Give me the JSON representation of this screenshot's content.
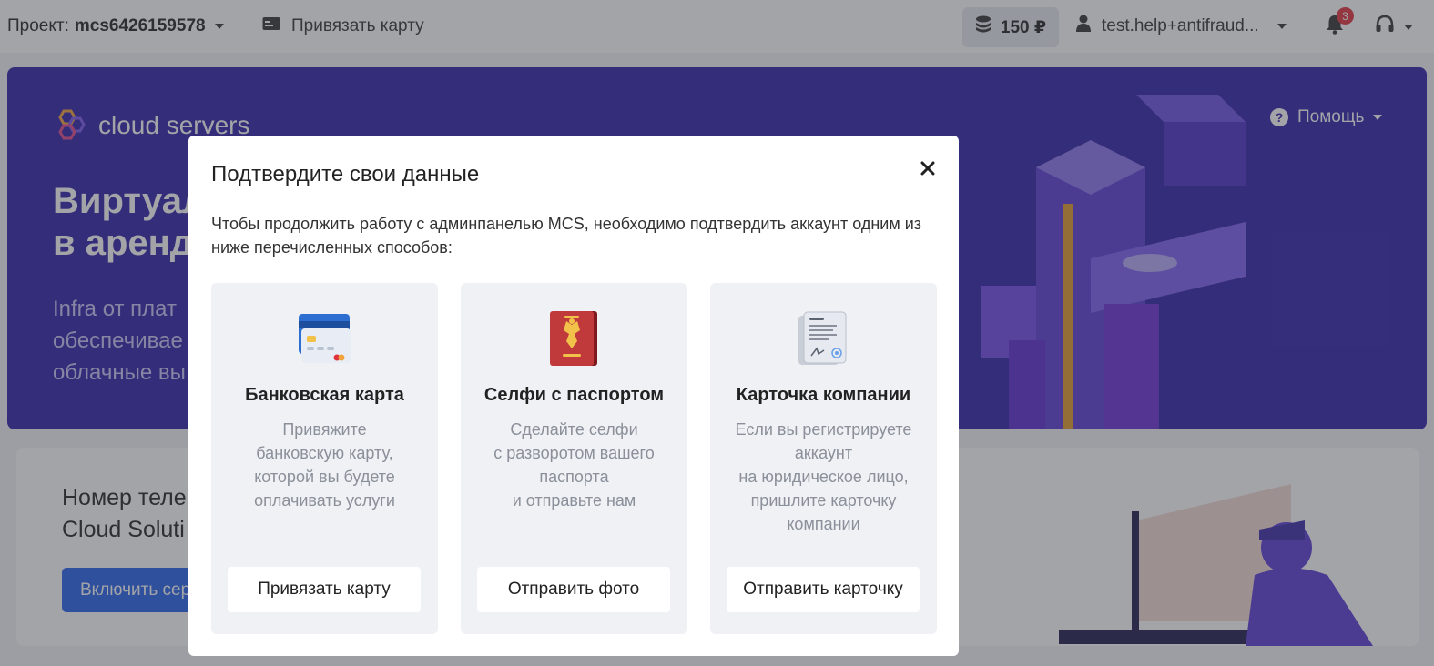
{
  "colors": {
    "hero_bg": "#2f1fa8",
    "primary_button": "#2460e8",
    "badge": "#e0323c",
    "option_card_bg": "#eff1f5",
    "overlay": "rgba(60,62,70,0.47)"
  },
  "header": {
    "project_label": "Проект:",
    "project_name": "mcs6426159578",
    "bind_card_label": "Привязать карту",
    "balance": "150 ₽",
    "user_email": "test.help+antifraud...",
    "notifications_count": "3",
    "icons": {
      "card": "credit-card-icon",
      "balance": "coins-stack-icon",
      "user": "user-icon",
      "bell": "bell-icon",
      "support": "headset-icon"
    }
  },
  "hero": {
    "logo_text": "cloud servers",
    "heading": "Виртуал\nв аренд",
    "subtitle": "Infra от плат\nобеспечивае\nоблачные вы",
    "help_label": "Помощь"
  },
  "phone_card": {
    "title": "Номер теле\nCloud Soluti",
    "button_label": "Включить сер"
  },
  "modal": {
    "title": "Подтвердите свои данные",
    "description": "Чтобы продолжить работу с админпанелью MCS, необходимо подтвердить аккаунт одним из ниже перечисленных способов:",
    "options": [
      {
        "title": "Банковская карта",
        "text": "Привяжите\nбанковскую карту,\nкоторой вы будете\nоплачивать услуги",
        "button": "Привязать карту",
        "icon": "bank-card-icon"
      },
      {
        "title": "Селфи с паспортом",
        "text": "Сделайте селфи\nс разворотом вашего\nпаспорта\nи отправьте нам",
        "button": "Отправить фото",
        "icon": "passport-icon"
      },
      {
        "title": "Карточка компании",
        "text": "Если вы регистрируете\nаккаунт\nна юридическое лицо,\nпришлите карточку\nкомпании",
        "button": "Отправить карточку",
        "icon": "company-document-icon"
      }
    ]
  }
}
